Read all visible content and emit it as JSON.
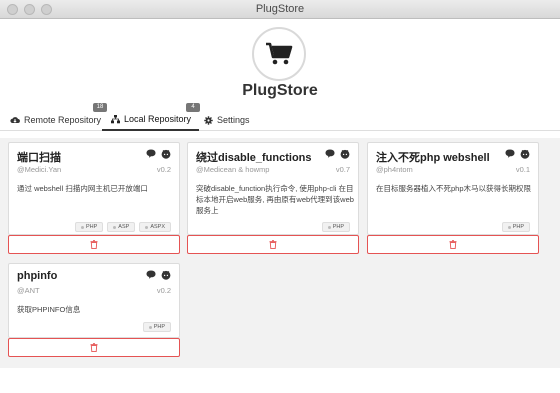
{
  "window": {
    "title": "PlugStore"
  },
  "header": {
    "app_name": "PlugStore",
    "logo_icon": "cart-icon"
  },
  "tabs": [
    {
      "label": "Remote Repository",
      "icon": "cloud-download-icon",
      "badge": "18",
      "active": false
    },
    {
      "label": "Local Repository",
      "icon": "sitemap-icon",
      "badge": "4",
      "active": true
    },
    {
      "label": "Settings",
      "icon": "gear-icon",
      "active": false
    }
  ],
  "plugins": [
    {
      "name": "端口扫描",
      "author": "@Medici.Yan",
      "version": "v0.2",
      "description": "通过 webshell 扫描内网主机已开放端口",
      "tags": [
        "PHP",
        "ASP",
        "ASPX"
      ]
    },
    {
      "name": "绕过disable_functions",
      "author": "@Medicean & howmp",
      "version": "v0.7",
      "description": "突破disable_function执行命令, 使用php-cli 在目标本地开启web服务, 再由原有web代理到该web服务上",
      "tags": [
        "PHP"
      ]
    },
    {
      "name": "注入不死php webshell",
      "author": "@ph4ntom",
      "version": "v0.1",
      "description": "在目标服务器植入不死php木马以获得长期权限",
      "tags": [
        "PHP"
      ]
    },
    {
      "name": "phpinfo",
      "author": "@ANT",
      "version": "v0.2",
      "description": "获取PHPINFO信息",
      "tags": [
        "PHP"
      ]
    }
  ],
  "colors": {
    "danger": "#e55353",
    "accent": "#333333"
  }
}
